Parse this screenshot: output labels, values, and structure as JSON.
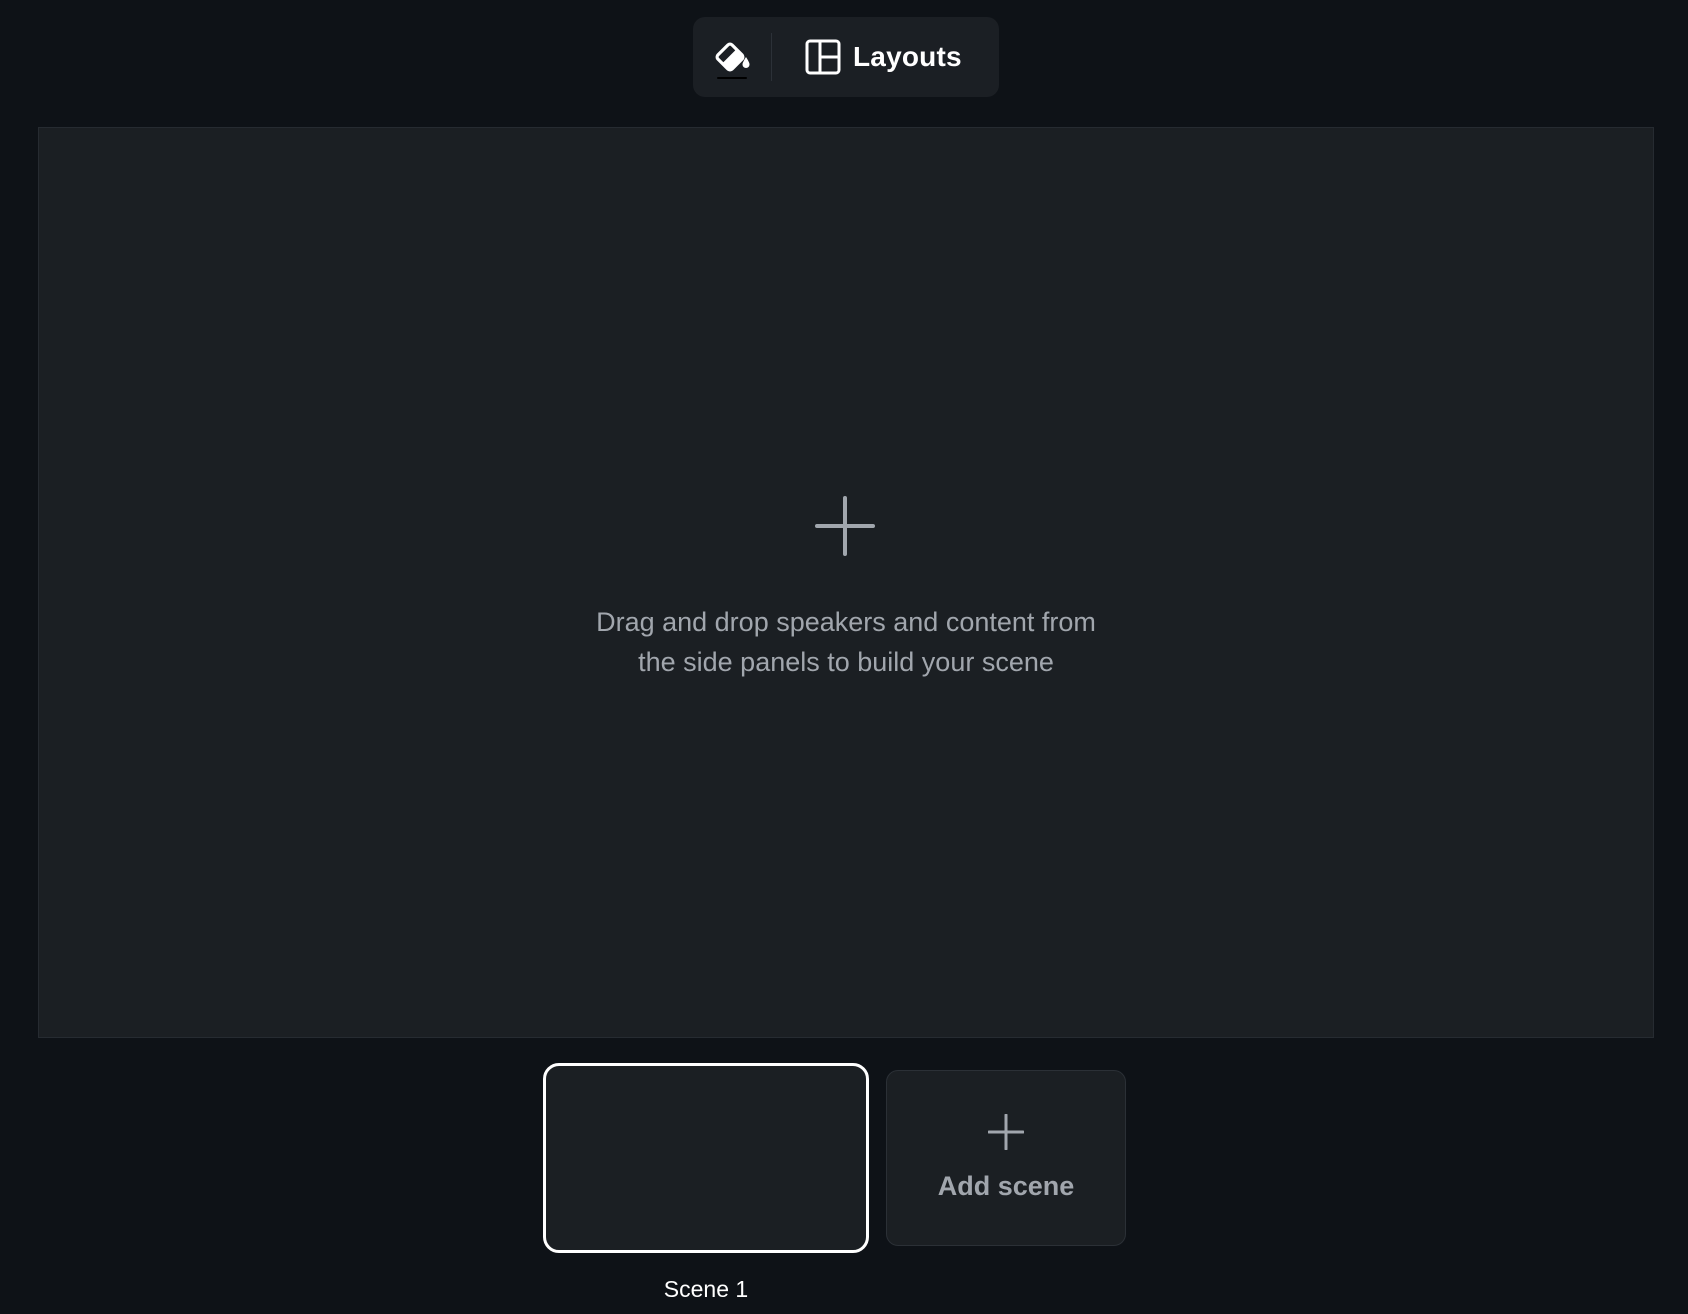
{
  "toolbar": {
    "theme_icon": "paint-bucket-icon",
    "layouts_icon": "layout-icon",
    "layouts_label": "Layouts"
  },
  "canvas": {
    "add_icon": "plus-icon",
    "hint": "Drag and drop speakers and content from\nthe side panels to build your scene"
  },
  "scenes": {
    "items": [
      {
        "label": "Scene 1",
        "selected": true
      }
    ],
    "add_icon": "plus-icon",
    "add_label": "Add scene"
  },
  "colors": {
    "background": "#0e1217",
    "panel": "#1b1f23",
    "muted_text": "#a1a6ad",
    "selected_border": "#ffffff"
  }
}
